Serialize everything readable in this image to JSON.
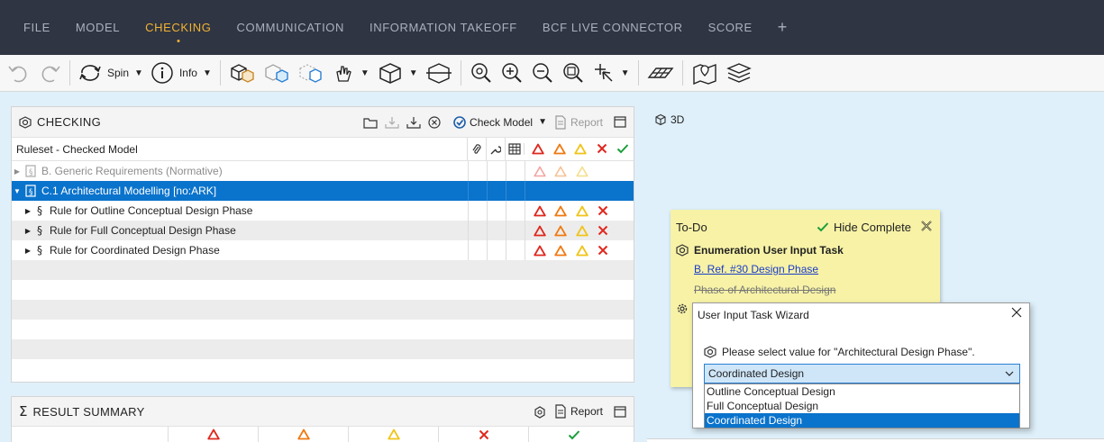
{
  "menu": {
    "items": [
      "FILE",
      "MODEL",
      "CHECKING",
      "COMMUNICATION",
      "INFORMATION TAKEOFF",
      "BCF LIVE CONNECTOR",
      "SCORE"
    ],
    "active": "CHECKING",
    "plus": "+"
  },
  "toolbar": {
    "spin_label": "Spin",
    "info_label": "Info"
  },
  "checking": {
    "title": "CHECKING",
    "check_model_label": "Check Model",
    "report_label": "Report",
    "column_header": "Ruleset - Checked Model",
    "rows": [
      {
        "label": "B. Generic Requirements (Normative)"
      },
      {
        "label": "C.1 Architectural Modelling [no:ARK]"
      },
      {
        "label": "Rule for Outline Conceptual Design Phase"
      },
      {
        "label": "Rule for Full Conceptual Design Phase"
      },
      {
        "label": "Rule for Coordinated Design Phase"
      }
    ]
  },
  "result_summary": {
    "title": "RESULT SUMMARY",
    "report_label": "Report"
  },
  "view": {
    "label_3d": "3D"
  },
  "todo": {
    "title": "To-Do",
    "hide_complete": "Hide Complete",
    "task_title": "Enumeration User Input Task",
    "link": "B. Ref. #30  Design Phase",
    "struck": "Phase of Architectural Design"
  },
  "wizard": {
    "title": "User Input Task Wizard",
    "prompt": "Please select value for \"Architectural Design Phase\".",
    "selected": "Coordinated Design",
    "options": [
      "Outline Conceptual Design",
      "Full Conceptual Design",
      "Coordinated Design"
    ]
  },
  "colors": {
    "menu_bg": "#2f3542",
    "accent": "#f2b233",
    "selection": "#0a73cc",
    "critical": "#e0281e",
    "major": "#f07a12",
    "minor": "#f0c419",
    "check_ok": "#1a9e3a"
  }
}
